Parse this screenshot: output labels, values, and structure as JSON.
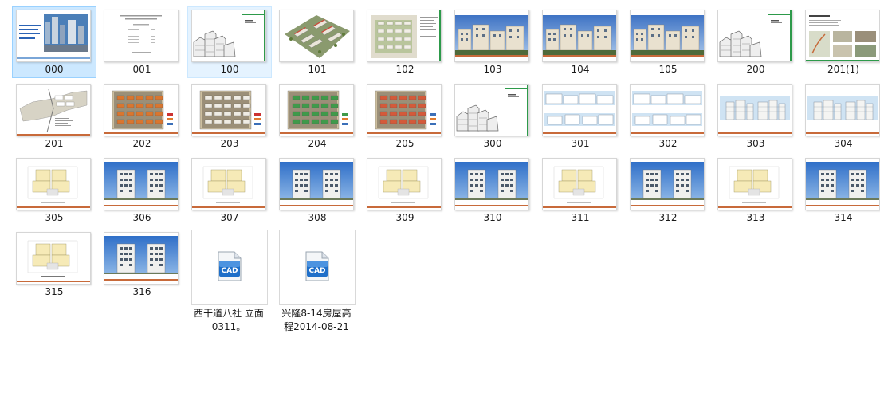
{
  "files": [
    {
      "name": "000",
      "kind": "cover",
      "selected": true
    },
    {
      "name": "001",
      "kind": "text"
    },
    {
      "name": "100",
      "kind": "sketch-cover",
      "hover": true
    },
    {
      "name": "101",
      "kind": "aerial"
    },
    {
      "name": "102",
      "kind": "siteplan"
    },
    {
      "name": "103",
      "kind": "street"
    },
    {
      "name": "104",
      "kind": "street"
    },
    {
      "name": "105",
      "kind": "street"
    },
    {
      "name": "200",
      "kind": "sketch-cover"
    },
    {
      "name": "201(1)",
      "kind": "layout"
    },
    {
      "name": "201",
      "kind": "mapplan"
    },
    {
      "name": "202",
      "kind": "colorplan-orange"
    },
    {
      "name": "203",
      "kind": "colorplan-gray"
    },
    {
      "name": "204",
      "kind": "colorplan-green"
    },
    {
      "name": "205",
      "kind": "colorplan-mixed"
    },
    {
      "name": "300",
      "kind": "sketch-cover"
    },
    {
      "name": "301",
      "kind": "elevation-strip"
    },
    {
      "name": "302",
      "kind": "elevation-strip"
    },
    {
      "name": "303",
      "kind": "elevation-tall"
    },
    {
      "name": "304",
      "kind": "elevation-tall"
    },
    {
      "name": "305",
      "kind": "floorplan"
    },
    {
      "name": "306",
      "kind": "elevation-blue"
    },
    {
      "name": "307",
      "kind": "floorplan"
    },
    {
      "name": "308",
      "kind": "elevation-blue"
    },
    {
      "name": "309",
      "kind": "floorplan"
    },
    {
      "name": "310",
      "kind": "elevation-blue"
    },
    {
      "name": "311",
      "kind": "floorplan"
    },
    {
      "name": "312",
      "kind": "elevation-blue"
    },
    {
      "name": "313",
      "kind": "floorplan"
    },
    {
      "name": "314",
      "kind": "elevation-blue"
    },
    {
      "name": "315",
      "kind": "floorplan"
    },
    {
      "name": "316",
      "kind": "elevation-blue"
    }
  ],
  "cad_files": [
    {
      "line1": "西干道八社  立面",
      "line2": "0311。"
    },
    {
      "line1": "兴隆8-14房屋高",
      "line2": "程2014-08-21"
    }
  ],
  "cad_icon_text": "CAD"
}
